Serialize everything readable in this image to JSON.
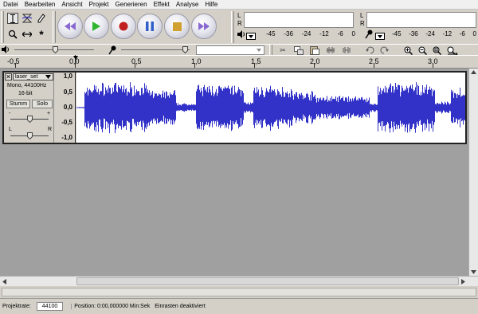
{
  "menu": [
    "Datei",
    "Bearbeiten",
    "Ansicht",
    "Projekt",
    "Generieren",
    "Effekt",
    "Analyse",
    "Hilfe"
  ],
  "meters": {
    "channel_left": "L",
    "channel_right": "R",
    "scale": [
      "-45",
      "-36",
      "-24",
      "-12",
      "-6",
      "0"
    ]
  },
  "timeline": {
    "labels": [
      "-0,5",
      "0,0",
      "0,5",
      "1,0",
      "1,5",
      "2,0",
      "2,5",
      "3,0"
    ]
  },
  "track": {
    "name": "laser_set",
    "format": "Mono, 44100Hz",
    "bitdepth": "16-bit",
    "mute_label": "Stumm",
    "solo_label": "Solo",
    "gain_minus": "-",
    "gain_plus": "+",
    "pan_left": "L",
    "pan_right": "R",
    "amplitude_labels": [
      "1,0",
      "0,5",
      "0,0",
      "-0,5",
      "-1,0"
    ],
    "wave_color": "#3232c8"
  },
  "status": {
    "rate_label": "Projektrate:",
    "rate_value": "44100",
    "position_text": "Position: 0:00,000000 Min:Sek",
    "snap_text": "Einrasten deaktiviert"
  },
  "colors": {
    "background": "#a0a0a0",
    "waveform": "#3232c8",
    "play": "#2fb52f",
    "record": "#c02020",
    "pause": "#3060c8",
    "stop": "#d0a030",
    "skip": "#8a6ad0"
  },
  "icons": {
    "select_tool": "ibeam-icon",
    "envelope_tool": "envelope-icon",
    "draw_tool": "pencil-icon",
    "zoom_tool": "zoom-icon",
    "timeshift_tool": "timeshift-icon",
    "multi_tool": "multi-tool-icon"
  }
}
